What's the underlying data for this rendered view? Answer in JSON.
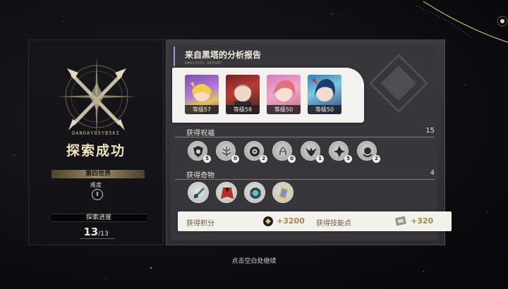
{
  "left_panel": {
    "caption": "DANOAYG5YB5KI",
    "result_title": "探索成功",
    "world": "第四世界",
    "difficulty_label": "难度",
    "difficulty_value": "Ⅱ",
    "progress_label": "探索进度",
    "progress_current": "13",
    "progress_total": "/13"
  },
  "report": {
    "title": "来自黑塔的分析报告",
    "subtitle": "ANALYSIS REPORT"
  },
  "characters": [
    {
      "level": "等级57"
    },
    {
      "level": "等级58"
    },
    {
      "level": "等级50"
    },
    {
      "level": "等级50"
    }
  ],
  "blessings": {
    "title": "获得祝福",
    "count": "15",
    "items": [
      {
        "icon": "preservation-icon",
        "count": "5"
      },
      {
        "icon": "abundance-icon",
        "count": "0"
      },
      {
        "icon": "remembrance-icon",
        "count": "2"
      },
      {
        "icon": "harmony-icon",
        "count": "0"
      },
      {
        "icon": "nihility-icon",
        "count": "1"
      },
      {
        "icon": "erudition-icon",
        "count": "5"
      },
      {
        "icon": "propagation-icon",
        "count": "2"
      }
    ]
  },
  "curios": {
    "title": "获得奇物",
    "count": "4",
    "items": [
      {
        "icon": "tool-curio-icon"
      },
      {
        "icon": "cloak-curio-icon"
      },
      {
        "icon": "orb-curio-icon"
      },
      {
        "icon": "card-curio-icon"
      }
    ]
  },
  "points": {
    "score_label": "获得积分",
    "score_value": "+3200",
    "skill_label": "获得技能点",
    "skill_value": "+320"
  },
  "continue_hint": "点击空白处继续"
}
